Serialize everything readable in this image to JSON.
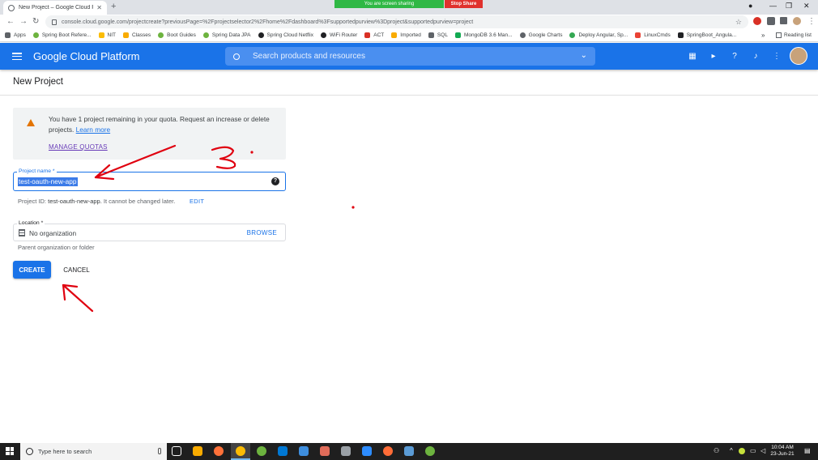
{
  "browser": {
    "tab_title": "New Project – Google Cloud Platform",
    "url": "console.cloud.google.com/projectcreate?previousPage=%2Fprojectselector2%2Fhome%2Fdashboard%3Fsupportedpurview%3Dproject&supportedpurview=project",
    "screen_sharing_text": "You are screen sharing",
    "stop_share_label": "Stop Share",
    "reading_list_label": "Reading list",
    "bookmarks": [
      {
        "label": "Apps",
        "color": "#5f6368"
      },
      {
        "label": "Spring Boot Refere...",
        "color": "#6db33f"
      },
      {
        "label": "NIT",
        "color": "#fbbc04"
      },
      {
        "label": "Classes",
        "color": "#f9ab00"
      },
      {
        "label": "Boot Guides",
        "color": "#6db33f"
      },
      {
        "label": "Spring Data JPA",
        "color": "#6db33f"
      },
      {
        "label": "Spring Cloud Netflix",
        "color": "#202124"
      },
      {
        "label": "WiFi Router",
        "color": "#202124"
      },
      {
        "label": "ACT",
        "color": "#d93025"
      },
      {
        "label": "Imported",
        "color": "#f9ab00"
      },
      {
        "label": "SQL",
        "color": "#5f6368"
      },
      {
        "label": "MongoDB 3.6 Man...",
        "color": "#13aa52"
      },
      {
        "label": "Google Charts",
        "color": "#5f6368"
      },
      {
        "label": "Deploy Angular, Sp...",
        "color": "#34a853"
      },
      {
        "label": "LinuxCmds",
        "color": "#ea4335"
      },
      {
        "label": "SpringBoot_Angula...",
        "color": "#202124"
      }
    ]
  },
  "header": {
    "product_title": "Google Cloud Platform",
    "search_placeholder": "Search products and resources",
    "brand_color": "#1a73e8"
  },
  "page": {
    "title": "New Project",
    "quota": {
      "message": "You have 1 project remaining in your quota. Request an increase or delete projects.",
      "learn_more": "Learn more",
      "manage_quotas": "MANAGE QUOTAS"
    },
    "project_name": {
      "label": "Project name *",
      "value": "test-oauth-new-app"
    },
    "project_id": {
      "prefix": "Project ID:",
      "value": "test-oauth-new-app.",
      "suffix": "It cannot be changed later.",
      "edit_label": "EDIT"
    },
    "location": {
      "label": "Location *",
      "value": "No organization",
      "browse_label": "BROWSE",
      "hint": "Parent organization or folder"
    },
    "create_label": "CREATE",
    "cancel_label": "CANCEL"
  },
  "annotations": {
    "handwritten_number": "3.",
    "color": "#e0000f"
  },
  "taskbar": {
    "search_placeholder": "Type here to search",
    "time": "10:04 AM",
    "date": "23-Jun-21"
  }
}
